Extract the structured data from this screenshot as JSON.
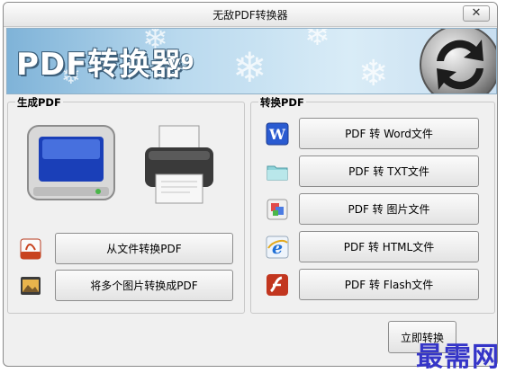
{
  "window": {
    "title": "无敌PDF转换器"
  },
  "banner": {
    "title": "PDF转换器",
    "version": "v9"
  },
  "left_group": {
    "label": "生成PDF",
    "buttons": [
      {
        "label": "从文件转换PDF",
        "icon": "pdf-file-icon"
      },
      {
        "label": "将多个图片转换成PDF",
        "icon": "image-photo-icon"
      }
    ]
  },
  "right_group": {
    "label": "转换PDF",
    "buttons": [
      {
        "label": "PDF 转 Word文件",
        "icon": "word-icon"
      },
      {
        "label": "PDF 转 TXT文件",
        "icon": "txt-folder-icon"
      },
      {
        "label": "PDF 转 图片文件",
        "icon": "picture-icon"
      },
      {
        "label": "PDF 转 HTML文件",
        "icon": "ie-browser-icon"
      },
      {
        "label": "PDF 转 Flash文件",
        "icon": "flash-icon"
      }
    ]
  },
  "footer": {
    "convert_label": "立即转换"
  },
  "watermark": {
    "text": "最需网"
  },
  "colors": {
    "accent": "#3535c8",
    "window_bg": "#f0f0f0",
    "banner": "#b9d9ee"
  }
}
